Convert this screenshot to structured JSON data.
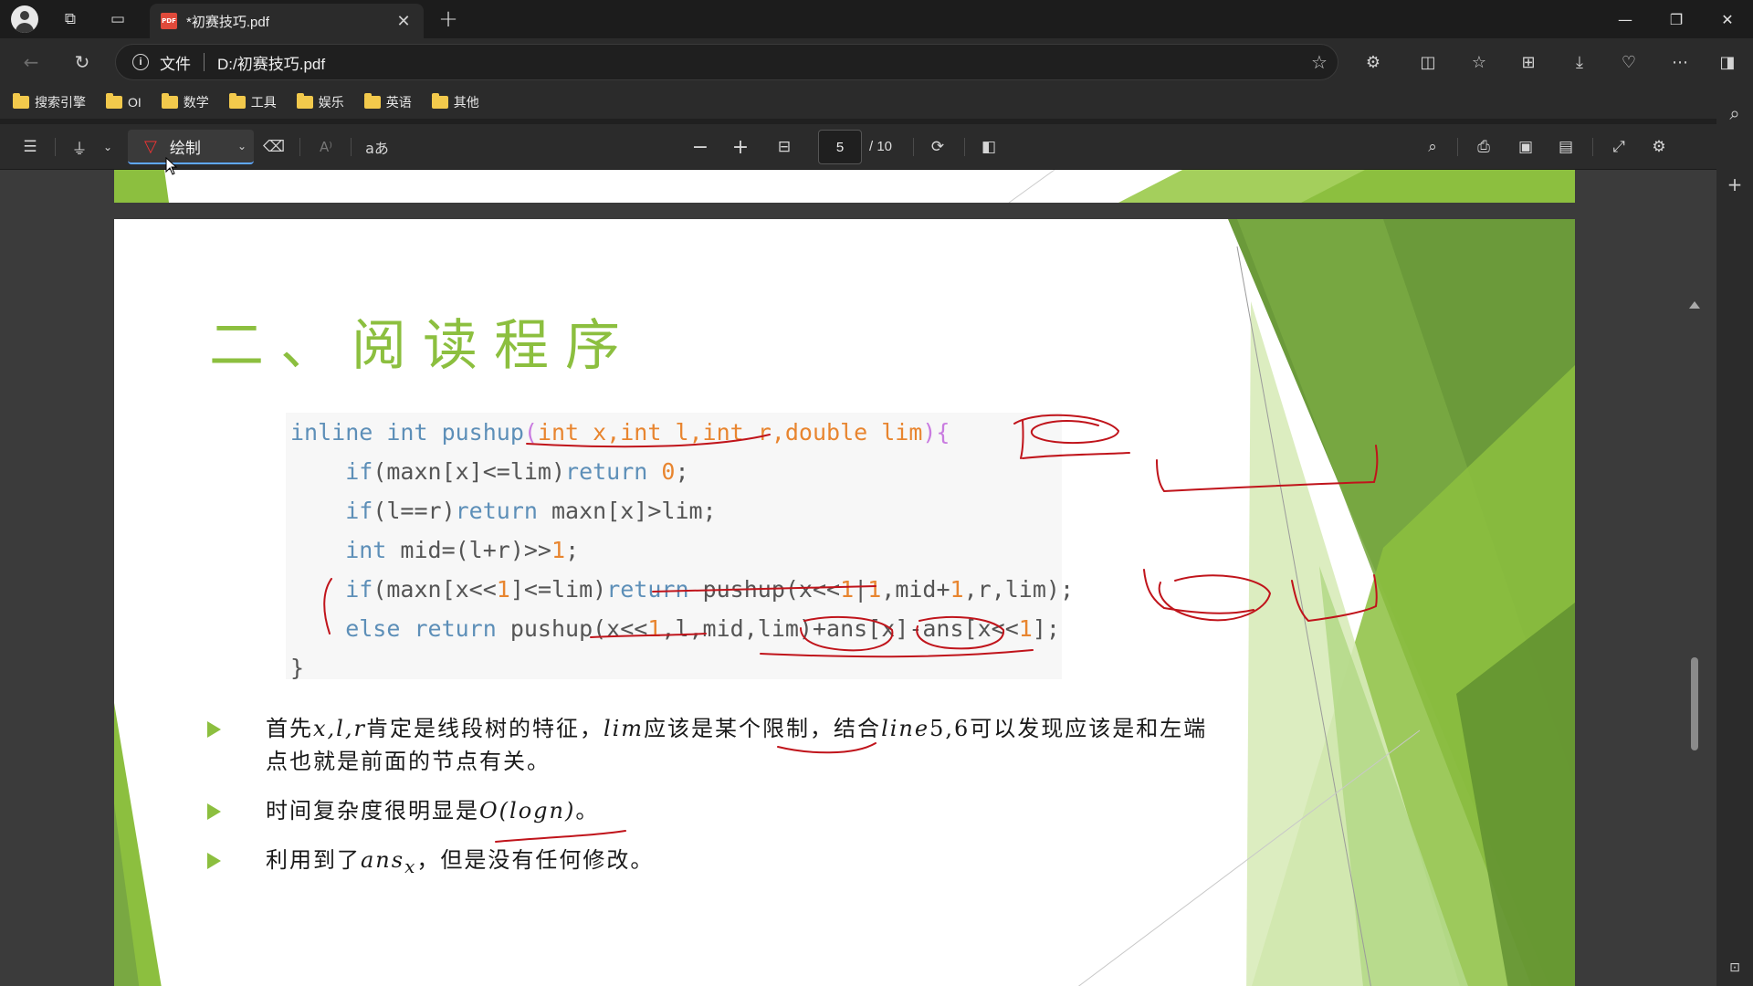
{
  "browser": {
    "tab": {
      "title": "*初赛技巧.pdf",
      "badge": "PDF"
    },
    "address": {
      "scheme_label": "文件",
      "url": "D:/初赛技巧.pdf"
    },
    "bookmarks": [
      "搜索引擎",
      "OI",
      "数学",
      "工具",
      "娱乐",
      "英语",
      "其他"
    ]
  },
  "pdf_toolbar": {
    "draw_label": "绘制",
    "text_tool": "aあ",
    "current_page": "5",
    "total_pages": "/ 10"
  },
  "slide": {
    "title": "二、阅读程序",
    "code": {
      "l1_a": "inline int pushup",
      "l1_b": "(",
      "l1_c": "int x,int l,int r,double lim",
      "l1_d": "){",
      "l2_a": "    if",
      "l2_b": "(maxn[x]<=lim)",
      "l2_c": "return ",
      "l2_d": "0",
      "l2_e": ";",
      "l3_a": "    if",
      "l3_b": "(l==r)",
      "l3_c": "return ",
      "l3_d": "maxn[x]>lim;",
      "l4_a": "    int ",
      "l4_b": "mid=(l+r)>>",
      "l4_c": "1",
      "l4_d": ";",
      "l5_a": "    if",
      "l5_b": "(maxn[x<<",
      "l5_c": "1",
      "l5_d": "]<=lim)",
      "l5_e": "return ",
      "l5_f": "pushup(x<<",
      "l5_g": "1",
      "l5_h": "|",
      "l5_i": "1",
      "l5_j": ",mid+",
      "l5_k": "1",
      "l5_l": ",r,lim);",
      "l6_a": "    else return ",
      "l6_b": "pushup(x<<",
      "l6_c": "1",
      "l6_d": ",l,mid,lim)+ans[x]-ans[x<<",
      "l6_e": "1",
      "l6_f": "];",
      "l7": "}"
    },
    "bullets": [
      {
        "p1": "首先",
        "m1": "x,l,r",
        "p2": "肯定是线段树的特征，",
        "m2": "lim",
        "p3": "应该是某个限制，结合",
        "m3": "line",
        "p4": "5,6可以发现应该是和左端点也就是前面的节点有关。"
      },
      {
        "p1": "时间复杂度很明显是",
        "m1": "O(logn)",
        "p2": "。"
      },
      {
        "p1": "利用到了",
        "m1": "ans",
        "sub": "x",
        "p2": "，但是没有任何修改。"
      }
    ]
  },
  "icons": [
    "profile-icon",
    "workspaces-icon",
    "tab-actions-icon",
    "pdf-file-icon",
    "close-icon",
    "plus-icon",
    "minimize-icon",
    "restore-icon",
    "back-icon",
    "refresh-icon",
    "info-icon",
    "favorite-star-icon",
    "extensions-icon",
    "split-screen-icon",
    "favorites-icon",
    "collections-icon",
    "downloads-icon",
    "performance-icon",
    "more-icon",
    "sidebar-toggle-icon",
    "search-icon",
    "contents-icon",
    "highlight-icon",
    "pen-icon",
    "eraser-icon",
    "read-aloud-icon",
    "zoom-out-icon",
    "zoom-in-icon",
    "fit-width-icon",
    "rotate-icon",
    "page-view-icon",
    "print-icon",
    "save-icon",
    "save-as-icon",
    "fullscreen-icon",
    "settings-icon"
  ],
  "colors": {
    "accent_green": "#8cbf3f",
    "ink_red": "#c0141b",
    "keyword_blue": "#5d8fb8",
    "number_orange": "#e8852f",
    "focus_blue": "#5fa8ff"
  }
}
